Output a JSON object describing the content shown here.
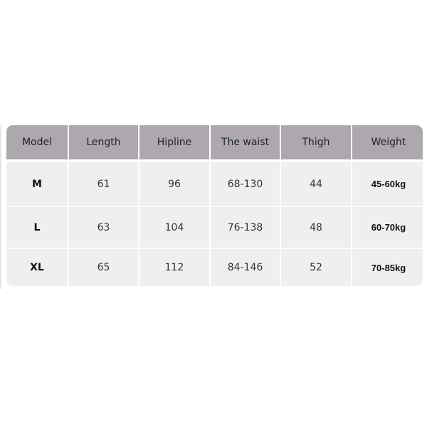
{
  "table": {
    "headers": [
      "Model",
      "Length",
      "Hipline",
      "The waist",
      "Thigh",
      "Weight"
    ],
    "rows": [
      [
        "M",
        "61",
        "96",
        "68-130",
        "44",
        "45-60kg"
      ],
      [
        "L",
        "63",
        "104",
        "76-138",
        "48",
        "60-70kg"
      ],
      [
        "XL",
        "65",
        "112",
        "84-146",
        "52",
        "70-85kg"
      ]
    ]
  },
  "colors": {
    "header_bg": "#aca8ae",
    "cell_bg": "#efefef"
  }
}
